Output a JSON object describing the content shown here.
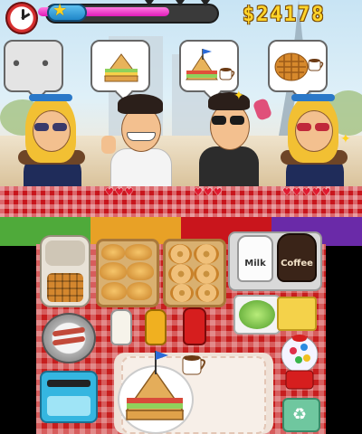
{
  "hud": {
    "money": "$24178",
    "star_progress": 0.74,
    "icons": {
      "clock": "clock-icon",
      "star": "star-icon",
      "money": "dollar-icon"
    }
  },
  "orders": [
    {
      "state": "waiting",
      "text": "• •",
      "hearts": ""
    },
    {
      "state": "order",
      "items": [
        "sandwich"
      ],
      "hearts": "♥♥♥"
    },
    {
      "state": "order",
      "items": [
        "sandwich",
        "coffee"
      ],
      "hearts": "♥♥♥"
    },
    {
      "state": "order",
      "items": [
        "waffle",
        "coffee"
      ],
      "hearts": "♥♥♥♥♥"
    }
  ],
  "stations": {
    "milk_label": "Milk",
    "coffee_label": "Coffee"
  },
  "colors": {
    "star_bar_fill": "#e01bb8",
    "money": "#ffd42a",
    "tablecloth": "#c8151c",
    "hearts": "#e0192f"
  }
}
